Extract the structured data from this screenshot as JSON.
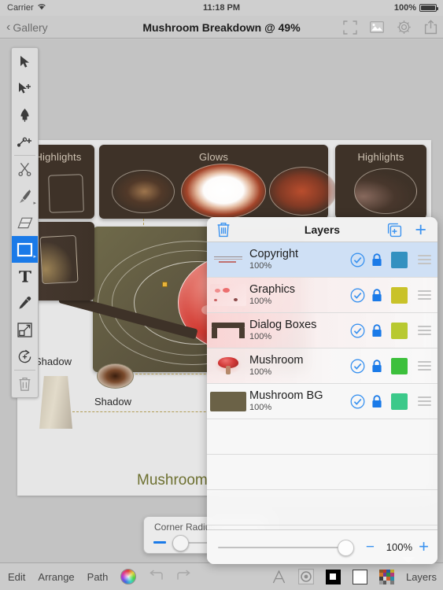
{
  "status_bar": {
    "carrier": "Carrier",
    "wifi_icon": "wifi-icon",
    "time": "11:18 PM",
    "battery_percent": "100%",
    "battery_icon": "battery-icon"
  },
  "nav_bar": {
    "back_label": "Gallery",
    "back_chevron_icon": "chevron-left-icon",
    "title": "Mushroom Breakdown @ 49%",
    "icons": [
      {
        "name": "fullscreen-icon"
      },
      {
        "name": "image-icon"
      },
      {
        "name": "settings-gear-icon"
      },
      {
        "name": "share-icon"
      }
    ]
  },
  "tools": [
    {
      "name": "select-arrow-tool",
      "icon": "cursor-arrow-icon",
      "selected": false,
      "submenu": false,
      "dim": false
    },
    {
      "name": "add-node-tool",
      "icon": "cursor-plus-icon",
      "selected": false,
      "submenu": false,
      "dim": false
    },
    {
      "name": "pen-tool",
      "icon": "pen-nib-icon",
      "selected": false,
      "submenu": false,
      "dim": false
    },
    {
      "name": "node-path-tool",
      "icon": "node-path-icon",
      "selected": false,
      "submenu": false,
      "dim": false
    },
    {
      "name": "scissors-tool",
      "icon": "scissors-icon",
      "selected": false,
      "submenu": false,
      "dim": true
    },
    {
      "name": "brush-tool",
      "icon": "paintbrush-icon",
      "selected": false,
      "submenu": true,
      "dim": true
    },
    {
      "name": "eraser-tool",
      "icon": "eraser-icon",
      "selected": false,
      "submenu": false,
      "dim": true
    },
    {
      "name": "rectangle-tool",
      "icon": "rectangle-icon",
      "selected": true,
      "submenu": true,
      "dim": false
    },
    {
      "name": "text-tool",
      "icon": "text-t-icon",
      "selected": false,
      "submenu": false,
      "dim": false
    },
    {
      "name": "eyedropper-tool",
      "icon": "eyedropper-icon",
      "selected": false,
      "submenu": false,
      "dim": false
    },
    {
      "name": "transform-tool",
      "icon": "scale-transform-icon",
      "selected": false,
      "submenu": false,
      "dim": false
    },
    {
      "name": "rotate-tool",
      "icon": "rotate-icon",
      "selected": false,
      "submenu": false,
      "dim": false
    },
    {
      "name": "delete-tool",
      "icon": "trash-icon",
      "selected": false,
      "submenu": false,
      "dim": true
    }
  ],
  "canvas": {
    "panel_highlights_left": "Highlights",
    "panel_glows": "Glows",
    "panel_highlights_right": "Highlights",
    "label_shadow_1": "Shadow",
    "label_shadow_2": "Shadow",
    "label_mushroom": "Mushroom"
  },
  "corner_radius_popover": {
    "label": "Corner Radius"
  },
  "layers_panel": {
    "title": "Layers",
    "trash_icon": "trash-icon",
    "duplicate_icon": "duplicate-layer-icon",
    "add_label": "+",
    "rows": [
      {
        "name": "Copyright",
        "opacity": "100%",
        "selected": true,
        "swatch": "#3391c0",
        "thumb": "copyright-text-thumb",
        "visible_icon": "check-circle-icon",
        "lock_icon": "lock-icon"
      },
      {
        "name": "Graphics",
        "opacity": "100%",
        "selected": false,
        "swatch": "#c9c229",
        "thumb": "graphics-thumb",
        "visible_icon": "check-circle-icon",
        "lock_icon": "lock-icon"
      },
      {
        "name": "Dialog Boxes",
        "opacity": "100%",
        "selected": false,
        "swatch": "#b8c930",
        "thumb": "dialog-boxes-thumb",
        "visible_icon": "check-circle-icon",
        "lock_icon": "lock-icon"
      },
      {
        "name": "Mushroom",
        "opacity": "100%",
        "selected": false,
        "swatch": "#3cc03c",
        "thumb": "mushroom-thumb",
        "visible_icon": "check-circle-icon",
        "lock_icon": "lock-icon"
      },
      {
        "name": "Mushroom BG",
        "opacity": "100%",
        "selected": false,
        "swatch": "#3cc98a",
        "thumb": "mushroom-bg-thumb",
        "visible_icon": "check-circle-icon",
        "lock_icon": "lock-icon"
      }
    ],
    "opacity_footer": {
      "minus_label": "−",
      "value": "100%",
      "plus_label": "+"
    }
  },
  "bottom_bar": {
    "edit_label": "Edit",
    "arrange_label": "Arrange",
    "path_label": "Path",
    "color_wheel_icon": "color-wheel-icon",
    "undo_icon": "undo-arrow-icon",
    "redo_icon": "redo-arrow-icon",
    "text_style_icon": "text-a-icon",
    "effects_icon": "effects-target-icon",
    "fill_icon": "fill-swatch-icon",
    "stroke_icon": "stroke-swatch-icon",
    "palette_icon": "color-palette-icon",
    "layers_label": "Layers"
  },
  "colors": {
    "accent_blue": "#1a7ae8",
    "link_blue": "#3b93f0",
    "panel_brown": "#3e3228",
    "artboard": "#e6e6e6",
    "chrome_gray": "#cbcbcb"
  }
}
